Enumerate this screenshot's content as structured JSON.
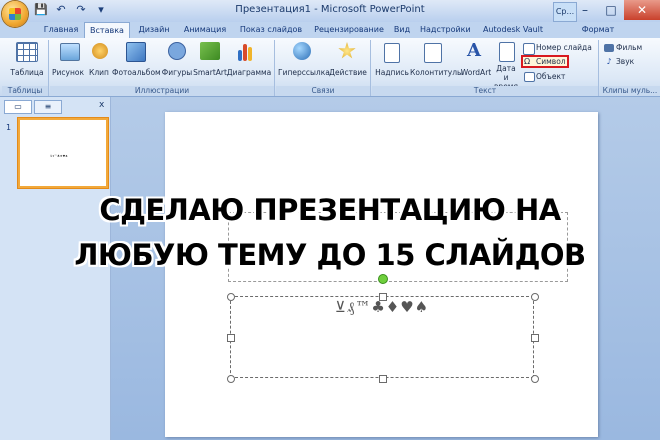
{
  "window": {
    "title": "Презентация1 - Microsoft PowerPoint",
    "context_tab": "Ср...",
    "minimize": "–",
    "maximize": "□",
    "close": "✕"
  },
  "qat": {
    "save": "💾",
    "undo": "↶",
    "redo": "↷",
    "customize": "▾"
  },
  "tabs": [
    "Главная",
    "Вставка",
    "Дизайн",
    "Анимация",
    "Показ слайдов",
    "Рецензирование",
    "Вид",
    "Надстройки",
    "Autodesk Vault",
    "Формат"
  ],
  "active_tab": "Вставка",
  "ribbon": {
    "table": "Таблица",
    "picture": "Рисунок",
    "clip": "Клип",
    "photo_album": "Фотоальбом",
    "shapes": "Фигуры",
    "smartart": "SmartArt",
    "chart": "Диаграмма",
    "hyperlink": "Гиперссылка",
    "action": "Действие",
    "textbox": "Надпись",
    "header_footer": "Колонтитулы",
    "wordart": "WordArt",
    "date_time": "Дата и время",
    "slide_number": "Номер слайда",
    "symbol": "Символ",
    "object": "Объект",
    "movie": "Фильм",
    "sound": "Звук",
    "groups": {
      "tables": "Таблицы",
      "illustrations": "Иллюстрации",
      "links": "Связи",
      "text": "Текст",
      "media": "Клипы муль..."
    }
  },
  "panel": {
    "slide_number": "1",
    "close": "x"
  },
  "slide": {
    "symbols": "⊻₰™♣♦♥♠"
  },
  "overlay": {
    "line1": "СДЕЛАЮ ПРЕЗЕНТАЦИЮ НА",
    "line2": "ЛЮБУЮ ТЕМУ ДО 15 СЛАЙДОВ"
  }
}
